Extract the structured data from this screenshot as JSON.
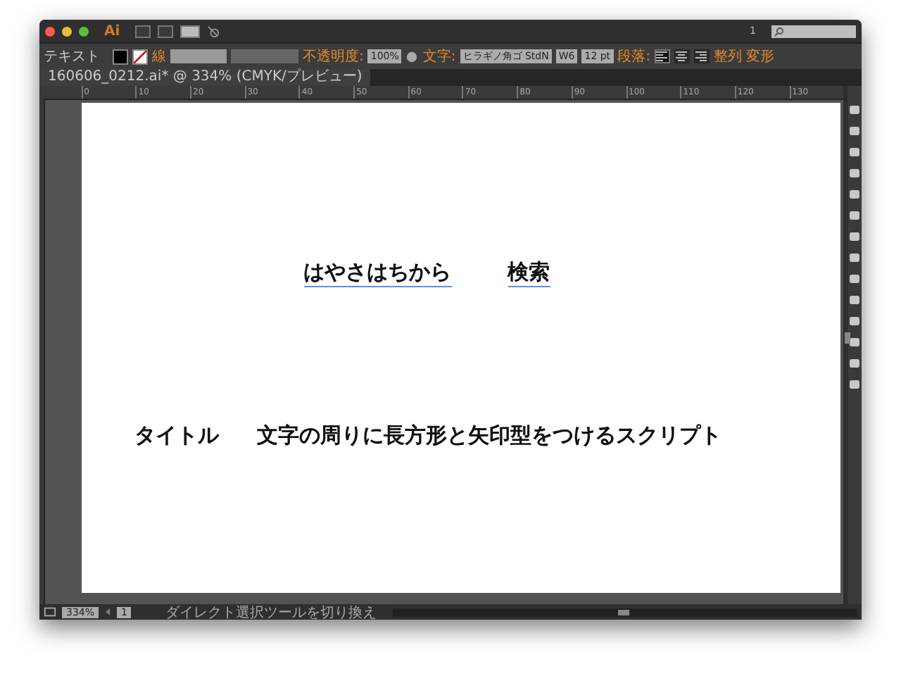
{
  "title_bar": {
    "app_logo": "Ai",
    "arrange_count": "1"
  },
  "control_bar": {
    "tool_label": "テキスト",
    "stroke_label": "線",
    "opacity_label": "不透明度:",
    "opacity_value": "100%",
    "character_label": "文字:",
    "font_family": "ヒラギノ角ゴ StdN",
    "font_weight": "W6",
    "font_size": "12 pt",
    "paragraph_label": "段落:",
    "align_buttons": [
      {
        "kind": "left",
        "selected": true
      },
      {
        "kind": "center",
        "selected": false
      },
      {
        "kind": "right",
        "selected": false
      }
    ],
    "align_link": "整列",
    "transform_link": "変形"
  },
  "document_tab": {
    "title": "160606_0212.ai* @ 334% (CMYK/プレビュー)"
  },
  "ruler": {
    "ticks": [
      "0",
      "10",
      "20",
      "30",
      "40",
      "50",
      "60",
      "70",
      "80",
      "90",
      "100",
      "110",
      "120",
      "130"
    ]
  },
  "artboard": {
    "lines": [
      {
        "texts": [
          {
            "text": "はやさはちから",
            "selected": true
          },
          {
            "text": "検索",
            "selected": true
          }
        ]
      },
      {
        "texts": [
          {
            "text": "タイトル",
            "selected": false
          },
          {
            "text": "文字の周りに長方形と矢印型をつけるスクリプト",
            "selected": false
          }
        ]
      }
    ]
  },
  "status_bar": {
    "zoom": "334%",
    "artboard_number": "1",
    "current_tool": "ダイレクト選択ツールを切り換え"
  }
}
